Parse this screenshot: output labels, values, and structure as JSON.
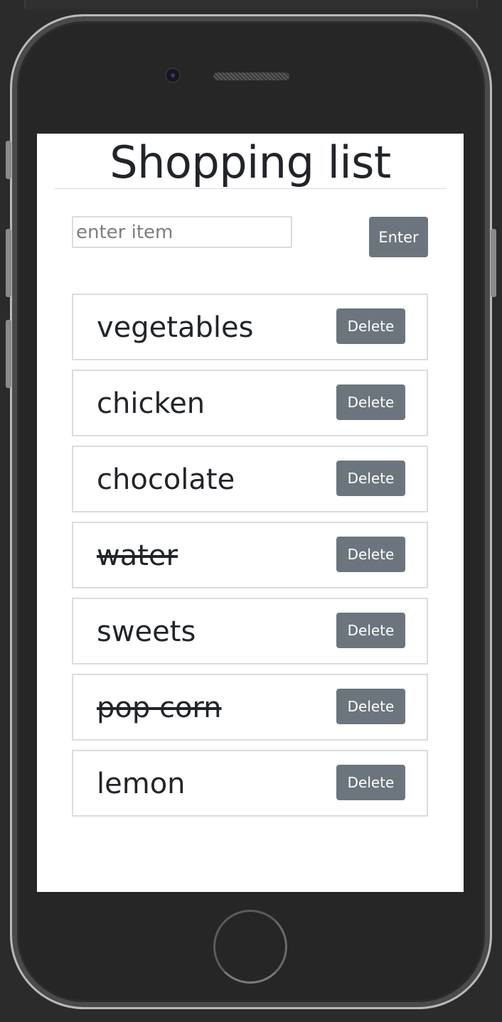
{
  "app": {
    "title": "Shopping list"
  },
  "form": {
    "placeholder": "enter item",
    "value": "",
    "enter_label": "Enter"
  },
  "items": [
    {
      "text": "vegetables",
      "completed": false,
      "delete_label": "Delete"
    },
    {
      "text": "chicken",
      "completed": false,
      "delete_label": "Delete"
    },
    {
      "text": "chocolate",
      "completed": false,
      "delete_label": "Delete"
    },
    {
      "text": "water",
      "completed": true,
      "delete_label": "Delete"
    },
    {
      "text": "sweets",
      "completed": false,
      "delete_label": "Delete"
    },
    {
      "text": "pop corn",
      "completed": true,
      "delete_label": "Delete"
    },
    {
      "text": "lemon",
      "completed": false,
      "delete_label": "Delete"
    }
  ],
  "colors": {
    "button_bg": "#6c757d",
    "text": "#212529",
    "border": "#dcdcdc",
    "device_frame": "#262626"
  }
}
